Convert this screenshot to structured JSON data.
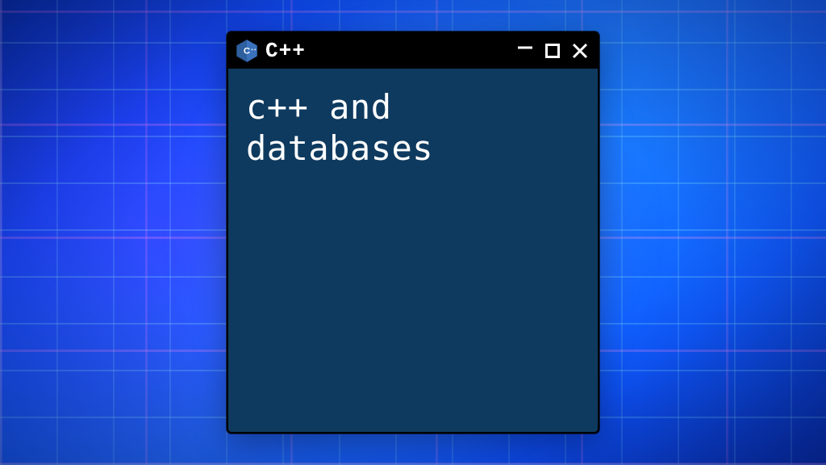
{
  "window": {
    "title": "C++",
    "icon_name": "cpp-hex-icon",
    "content_lines": [
      "c++ and",
      "databases"
    ]
  },
  "colors": {
    "titlebar_bg": "#000000",
    "window_bg": "#0f3a5f",
    "text": "#ffffff"
  }
}
